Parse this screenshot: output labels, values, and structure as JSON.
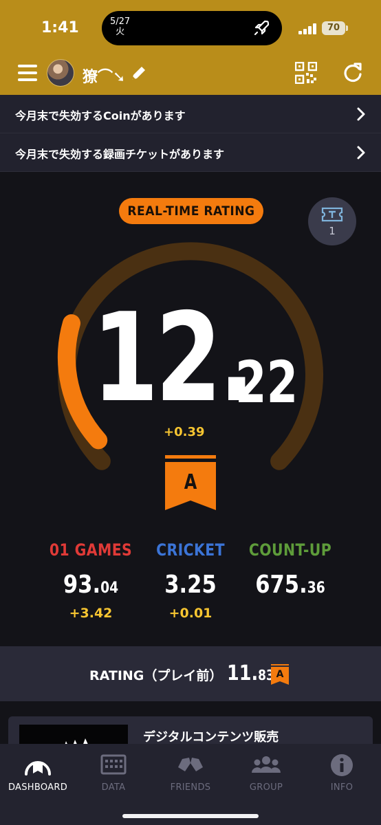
{
  "status_bar": {
    "time": "1:41",
    "date": "5/27",
    "weekday": "火",
    "battery": "70"
  },
  "header": {
    "username": "獠⌒➘"
  },
  "notices": [
    {
      "text": "今月末で失効するCoinがあります"
    },
    {
      "text": "今月末で失効する録画チケットがあります"
    }
  ],
  "rating": {
    "badge": "REAL-TIME RATING",
    "ticket_count": "1",
    "integer": "12.",
    "decimal": "22",
    "diff": "+0.39",
    "grade": "A",
    "gauge_fraction": 0.22
  },
  "stats": [
    {
      "label": "01 GAMES",
      "value_int": "93.",
      "value_dec": "04",
      "diff": "+3.42",
      "color": "#e03a37"
    },
    {
      "label": "CRICKET",
      "value_int": "3.25",
      "value_dec": "",
      "diff": "+0.01",
      "color": "#3b74d6"
    },
    {
      "label": "COUNT-UP",
      "value_int": "675.",
      "value_dec": "36",
      "diff": "",
      "color": "#5e9c3a"
    }
  ],
  "before": {
    "label": "RATING（プレイ前）",
    "value_int": "11.",
    "value_dec": "83",
    "grade": "A"
  },
  "promo": {
    "title": "デジタルコンテンツ販売"
  },
  "tabs": [
    {
      "label": "DASHBOARD",
      "icon": "dashboard-icon"
    },
    {
      "label": "DATA",
      "icon": "data-icon"
    },
    {
      "label": "FRIENDS",
      "icon": "friends-icon"
    },
    {
      "label": "GROUP",
      "icon": "group-icon"
    },
    {
      "label": "INFO",
      "icon": "info-icon"
    }
  ],
  "colors": {
    "header_gold": "#b98d1a",
    "accent_orange": "#f47b0e",
    "gauge_track": "#4a3012",
    "diff_yellow": "#f7c531"
  }
}
